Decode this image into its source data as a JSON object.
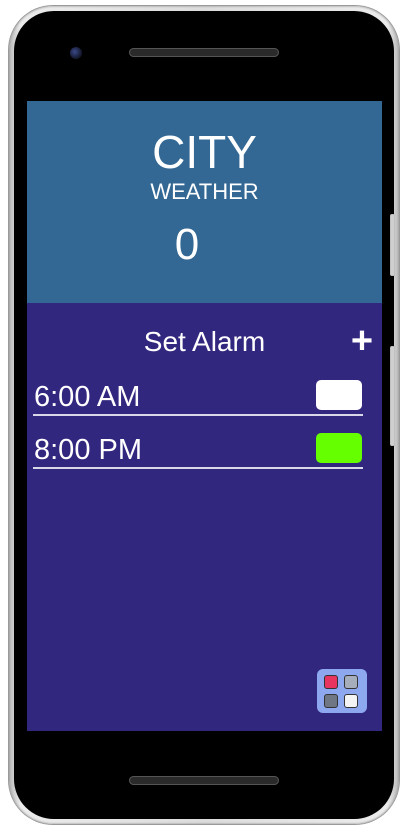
{
  "weather": {
    "city": "CITY",
    "label": "WEATHER",
    "temperature": "0"
  },
  "alarms": {
    "title": "Set Alarm",
    "add_label": "+",
    "items": [
      {
        "time": "6:00 AM",
        "enabled": false
      },
      {
        "time": "8:00 PM",
        "enabled": true
      }
    ]
  },
  "icons": {
    "add": "plus-icon",
    "apps": "apps-grid-icon"
  },
  "colors": {
    "weather_bg": "#336894",
    "alarm_bg": "#32277f",
    "toggle_off": "#ffffff",
    "toggle_on": "#66ff00",
    "app_icon_bg": "#8ea8f0"
  }
}
